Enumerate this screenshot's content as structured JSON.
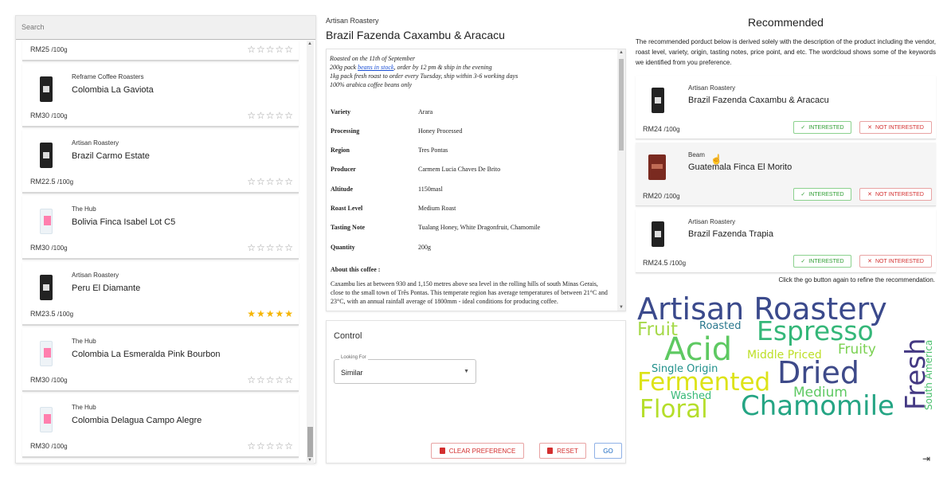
{
  "search": {
    "placeholder": "Search"
  },
  "product_list": [
    {
      "vendor": "",
      "name": "",
      "price": "RM25",
      "unit": "/100g",
      "stars": "☆☆☆☆☆",
      "rated": false,
      "bag": "dark"
    },
    {
      "vendor": "Reframe Coffee Roasters",
      "name": "Colombia La Gaviota",
      "price": "RM30",
      "unit": "/100g",
      "stars": "☆☆☆☆☆",
      "rated": false,
      "bag": "dark"
    },
    {
      "vendor": "Artisan Roastery",
      "name": "Brazil Carmo Estate",
      "price": "RM22.5",
      "unit": "/100g",
      "stars": "☆☆☆☆☆",
      "rated": false,
      "bag": "dark"
    },
    {
      "vendor": "The Hub",
      "name": "Bolivia Finca Isabel Lot C5",
      "price": "RM30",
      "unit": "/100g",
      "stars": "☆☆☆☆☆",
      "rated": false,
      "bag": "white"
    },
    {
      "vendor": "Artisan Roastery",
      "name": "Peru El Diamante",
      "price": "RM23.5",
      "unit": "/100g",
      "stars": "★★★★★",
      "rated": true,
      "bag": "dark"
    },
    {
      "vendor": "The Hub",
      "name": "Colombia La Esmeralda Pink Bourbon",
      "price": "RM30",
      "unit": "/100g",
      "stars": "☆☆☆☆☆",
      "rated": false,
      "bag": "white"
    },
    {
      "vendor": "The Hub",
      "name": "Colombia Delagua Campo Alegre",
      "price": "RM30",
      "unit": "/100g",
      "stars": "☆☆☆☆☆",
      "rated": false,
      "bag": "white"
    }
  ],
  "detail": {
    "vendor": "Artisan Roastery",
    "title": "Brazil Fazenda Caxambu & Aracacu",
    "desc_line1": "Roasted on the 11th of September",
    "desc_line2_pre": "200g pack ",
    "desc_line2_link": "beans in stock",
    "desc_line2_post": ", order by 12 pm & ship in the evening",
    "desc_line3": "1kg pack fresh roast to order every Tuesday, ship within 3-6 working days",
    "desc_line4": "100% arabica coffee beans only",
    "specs": [
      {
        "k": "Variety",
        "v": "Arara"
      },
      {
        "k": "Processing",
        "v": "Honey Processed"
      },
      {
        "k": "Region",
        "v": "Tres Pontas"
      },
      {
        "k": "Producer",
        "v": "Carmem Lucia Chaves De Brito"
      },
      {
        "k": "Altitude",
        "v": "1150masl"
      },
      {
        "k": "Roast Level",
        "v": "Medium Roast"
      },
      {
        "k": "Tasting Note",
        "v": "Tualang Honey, White Dragonfruit, Chamomile"
      },
      {
        "k": "Quantity",
        "v": "200g"
      }
    ],
    "about_label": "About this coffee :",
    "about_text": "Caxambu lies at between 930 and 1,150 metres above sea level in the rolling hills of south Minas Gerais, close to the small town of Três Pontas. This temperate region has average temperatures of between 21°C and 23°C, with an annual rainfall average of 1800mm - ideal conditions for producing coffee."
  },
  "control": {
    "title": "Control",
    "looking_for_label": "Looking For",
    "looking_for_value": "Similar",
    "clear_label": "CLEAR PREFERENCE",
    "reset_label": "RESET",
    "go_label": "GO"
  },
  "recommended": {
    "title": "Recommended",
    "description": "The recommended porduct below is derived solely with the description of the product including the vendor, roast level, variety, origin, tasting notes, price point, and etc. The wordcloud shows some of the keywords we identified from you preference.",
    "items": [
      {
        "vendor": "Artisan Roastery",
        "name": "Brazil Fazenda Caxambu & Aracacu",
        "price": "RM24",
        "unit": "/100g"
      },
      {
        "vendor": "Beam",
        "name": "Guatemala Finca El Morito",
        "price": "RM20",
        "unit": "/100g"
      },
      {
        "vendor": "Artisan Roastery",
        "name": "Brazil Fazenda Trapia",
        "price": "RM24.5",
        "unit": "/100g"
      }
    ],
    "interested_label": "INTERESTED",
    "not_interested_label": "NOT INTERESTED",
    "refine_text": "Click the go button again to refine the recommendation."
  },
  "wordcloud": [
    {
      "text": "Artisan Roastery",
      "color": "#3b4a8c"
    },
    {
      "text": "Fruit",
      "color": "#a6d94a"
    },
    {
      "text": "Roasted",
      "color": "#2a788e"
    },
    {
      "text": "Espresso",
      "color": "#35b779"
    },
    {
      "text": "Acid",
      "color": "#5ec962"
    },
    {
      "text": "Middle Priced",
      "color": "#bddf26"
    },
    {
      "text": "Fruity",
      "color": "#7ad151"
    },
    {
      "text": "Fresh",
      "color": "#443983"
    },
    {
      "text": "Single Origin",
      "color": "#21918c"
    },
    {
      "text": "Dried",
      "color": "#3e4a89"
    },
    {
      "text": "Fermented",
      "color": "#dde318"
    },
    {
      "text": "Medium",
      "color": "#5ec962"
    },
    {
      "text": "South America",
      "color": "#4ac16d"
    },
    {
      "text": "Washed",
      "color": "#38b977"
    },
    {
      "text": "Chamomile",
      "color": "#25a584"
    },
    {
      "text": "Floral",
      "color": "#b5de2b"
    }
  ]
}
